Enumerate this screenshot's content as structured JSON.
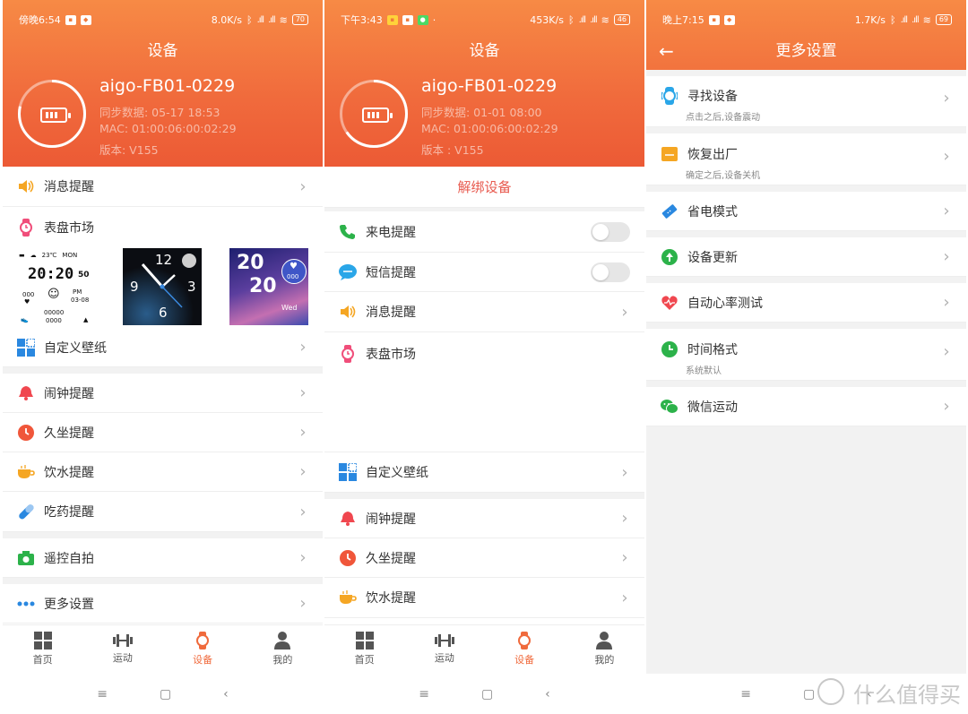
{
  "screen1": {
    "status": {
      "time": "傍晚6:54",
      "speed": "8.0K/s",
      "battery": "70"
    },
    "title": "设备",
    "device": {
      "name": "aigo-FB01-0229",
      "sync": "同步数据: 05-17 18:53",
      "mac": "MAC: 01:00:06:00:02:29",
      "version": "版本: V155"
    },
    "rows": {
      "message": "消息提醒",
      "watchface": "表盘市场",
      "wallpaper": "自定义壁纸",
      "alarm": "闹钟提醒",
      "sedentary": "久坐提醒",
      "water": "饮水提醒",
      "medicine": "吃药提醒",
      "selfie": "遥控自拍",
      "more": "更多设置"
    },
    "faces": {
      "f1": {
        "temp": "23℃",
        "day": "MON",
        "time": "20:20",
        "sec": "50",
        "ampm": "PM",
        "date": "03-08",
        "v1": "000",
        "v2": "00000",
        "v3": "0000"
      },
      "f2": {
        "n12": "12",
        "n9": "9",
        "n3": "3",
        "n6": "6"
      },
      "f3": {
        "h": "20",
        "m": "20",
        "hr": "000",
        "day": "Wed"
      }
    }
  },
  "screen2": {
    "status": {
      "time": "下午3:43",
      "speed": "453K/s",
      "battery": "46"
    },
    "title": "设备",
    "device": {
      "name": "aigo-FB01-0229",
      "sync": "同步数据: 01-01 08:00",
      "mac": "MAC: 01:00:06:00:02:29",
      "version": "版本 : V155"
    },
    "unbind": "解绑设备",
    "rows": {
      "call": "来电提醒",
      "sms": "短信提醒",
      "message": "消息提醒",
      "watchface": "表盘市场",
      "wallpaper": "自定义壁纸",
      "alarm": "闹钟提醒",
      "sedentary": "久坐提醒",
      "water": "饮水提醒"
    }
  },
  "screen3": {
    "status": {
      "time": "晚上7:15",
      "speed": "1.7K/s",
      "battery": "69"
    },
    "title": "更多设置",
    "rows": {
      "find": "寻找设备",
      "find_sub": "点击之后,设备震动",
      "reset": "恢复出厂",
      "reset_sub": "确定之后,设备关机",
      "power": "省电模式",
      "update": "设备更新",
      "heart": "自动心率测试",
      "timefmt": "时间格式",
      "timefmt_sub": "系统默认",
      "wechat": "微信运动"
    }
  },
  "tabs": {
    "home": "首页",
    "sport": "运动",
    "device": "设备",
    "mine": "我的"
  },
  "nav": {
    "menu": "≡",
    "home": "▢",
    "back": "‹"
  },
  "watermark": "什么值得买",
  "colors": {
    "accent": "#f06a3c",
    "header_top": "#f78a45",
    "header_bottom": "#ec5a35",
    "unbind": "#e85a4f"
  }
}
